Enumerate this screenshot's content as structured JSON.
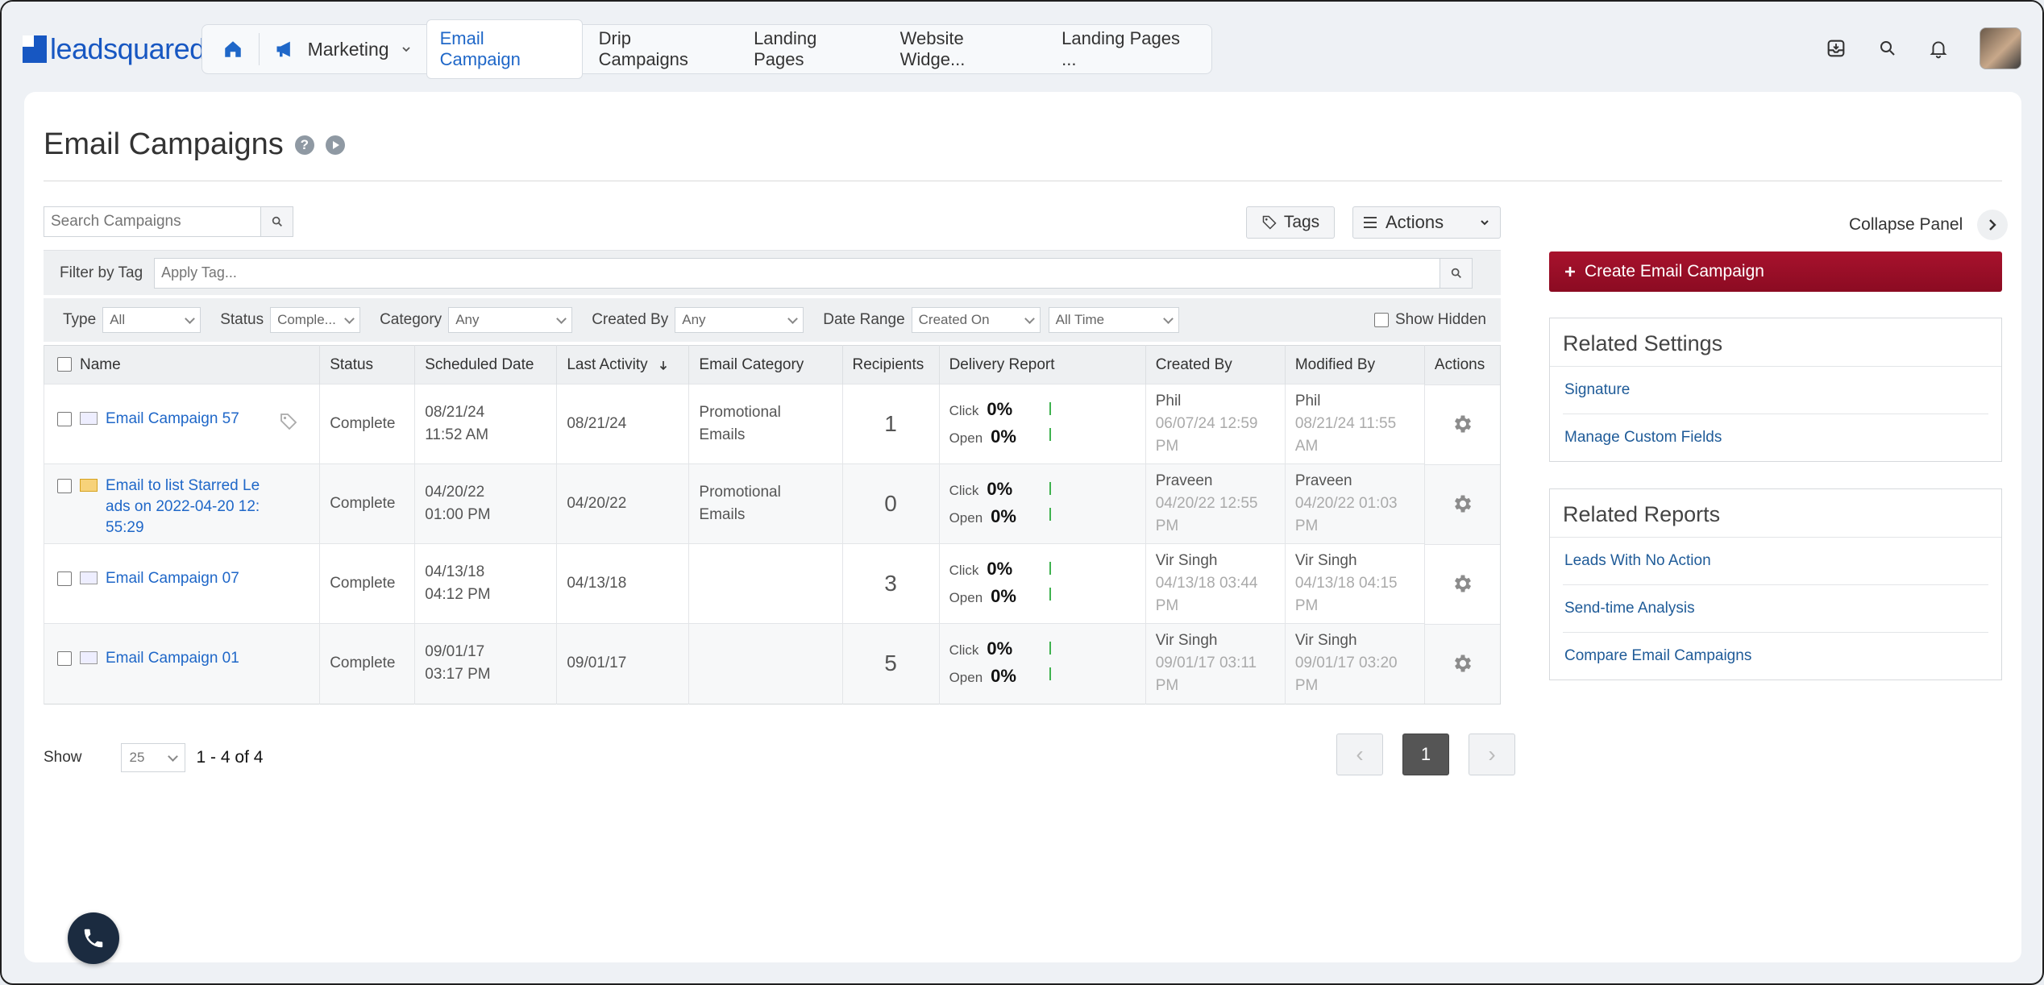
{
  "brand": {
    "name": "leadsquared"
  },
  "nav": {
    "module": "Marketing",
    "tabs": [
      {
        "label": "Email Campaign",
        "active": true
      },
      {
        "label": "Drip Campaigns"
      },
      {
        "label": "Landing Pages"
      },
      {
        "label": "Website Widge..."
      },
      {
        "label": "Landing Pages ..."
      }
    ]
  },
  "page": {
    "title": "Email Campaigns"
  },
  "toolbar": {
    "search_placeholder": "Search Campaigns",
    "tags_label": "Tags",
    "actions_label": "Actions"
  },
  "filters": {
    "filter_by_tag_label": "Filter by Tag",
    "apply_tag_placeholder": "Apply Tag...",
    "type_label": "Type",
    "type_value": "All",
    "status_label": "Status",
    "status_value": "Comple...",
    "category_label": "Category",
    "category_value": "Any",
    "created_by_label": "Created By",
    "created_by_value": "Any",
    "date_range_label": "Date Range",
    "date_field_value": "Created On",
    "date_range_value": "All Time",
    "show_hidden_label": "Show Hidden"
  },
  "table": {
    "columns": [
      "Name",
      "Status",
      "Scheduled Date",
      "Last Activity",
      "Email Category",
      "Recipients",
      "Delivery Report",
      "Created By",
      "Modified By",
      "Actions"
    ],
    "rows": [
      {
        "name": "Email Campaign 57",
        "status": "Complete",
        "sched_date": "08/21/24",
        "sched_time": "11:52 AM",
        "last_activity": "08/21/24",
        "category_l1": "Promotional",
        "category_l2": "Emails",
        "recipients": "1",
        "click": "0%",
        "open": "0%",
        "created_by": "Phil",
        "created_at1": "06/07/24 12:59",
        "created_at2": "PM",
        "modified_by": "Phil",
        "modified_at1": "08/21/24 11:55",
        "modified_at2": "AM"
      },
      {
        "name_l1": "Email to list Starred Le",
        "name_l2": "ads on 2022-04-20 12:",
        "name_l3": "55:29",
        "status": "Complete",
        "sched_date": "04/20/22",
        "sched_time": "01:00 PM",
        "last_activity": "04/20/22",
        "category_l1": "Promotional",
        "category_l2": "Emails",
        "recipients": "0",
        "click": "0%",
        "open": "0%",
        "created_by": "Praveen",
        "created_at1": "04/20/22 12:55",
        "created_at2": "PM",
        "modified_by": "Praveen",
        "modified_at1": "04/20/22 01:03",
        "modified_at2": "PM"
      },
      {
        "name": "Email Campaign 07",
        "status": "Complete",
        "sched_date": "04/13/18",
        "sched_time": "04:12 PM",
        "last_activity": "04/13/18",
        "recipients": "3",
        "click": "0%",
        "open": "0%",
        "created_by": "Vir Singh",
        "created_at1": "04/13/18 03:44",
        "created_at2": "PM",
        "modified_by": "Vir Singh",
        "modified_at1": "04/13/18 04:15",
        "modified_at2": "PM"
      },
      {
        "name": "Email Campaign 01",
        "status": "Complete",
        "sched_date": "09/01/17",
        "sched_time": "03:17 PM",
        "last_activity": "09/01/17",
        "recipients": "5",
        "click": "0%",
        "open": "0%",
        "created_by": "Vir Singh",
        "created_at1": "09/01/17 03:11",
        "created_at2": "PM",
        "modified_by": "Vir Singh",
        "modified_at1": "09/01/17 03:20",
        "modified_at2": "PM"
      }
    ],
    "click_label": "Click",
    "open_label": "Open"
  },
  "pagination": {
    "show_label": "Show",
    "page_size": "25",
    "range": "1 - 4 of 4",
    "current_page": "1"
  },
  "right_panel": {
    "collapse_label": "Collapse Panel",
    "create_label": "Create Email Campaign",
    "related_settings": {
      "title": "Related Settings",
      "links": [
        "Signature",
        "Manage Custom Fields"
      ]
    },
    "related_reports": {
      "title": "Related Reports",
      "links": [
        "Leads With No Action",
        "Send-time Analysis",
        "Compare Email Campaigns"
      ]
    }
  },
  "colors": {
    "accent": "#1f67c8",
    "create_button": "#9c0f28",
    "link": "#1f5b98"
  }
}
